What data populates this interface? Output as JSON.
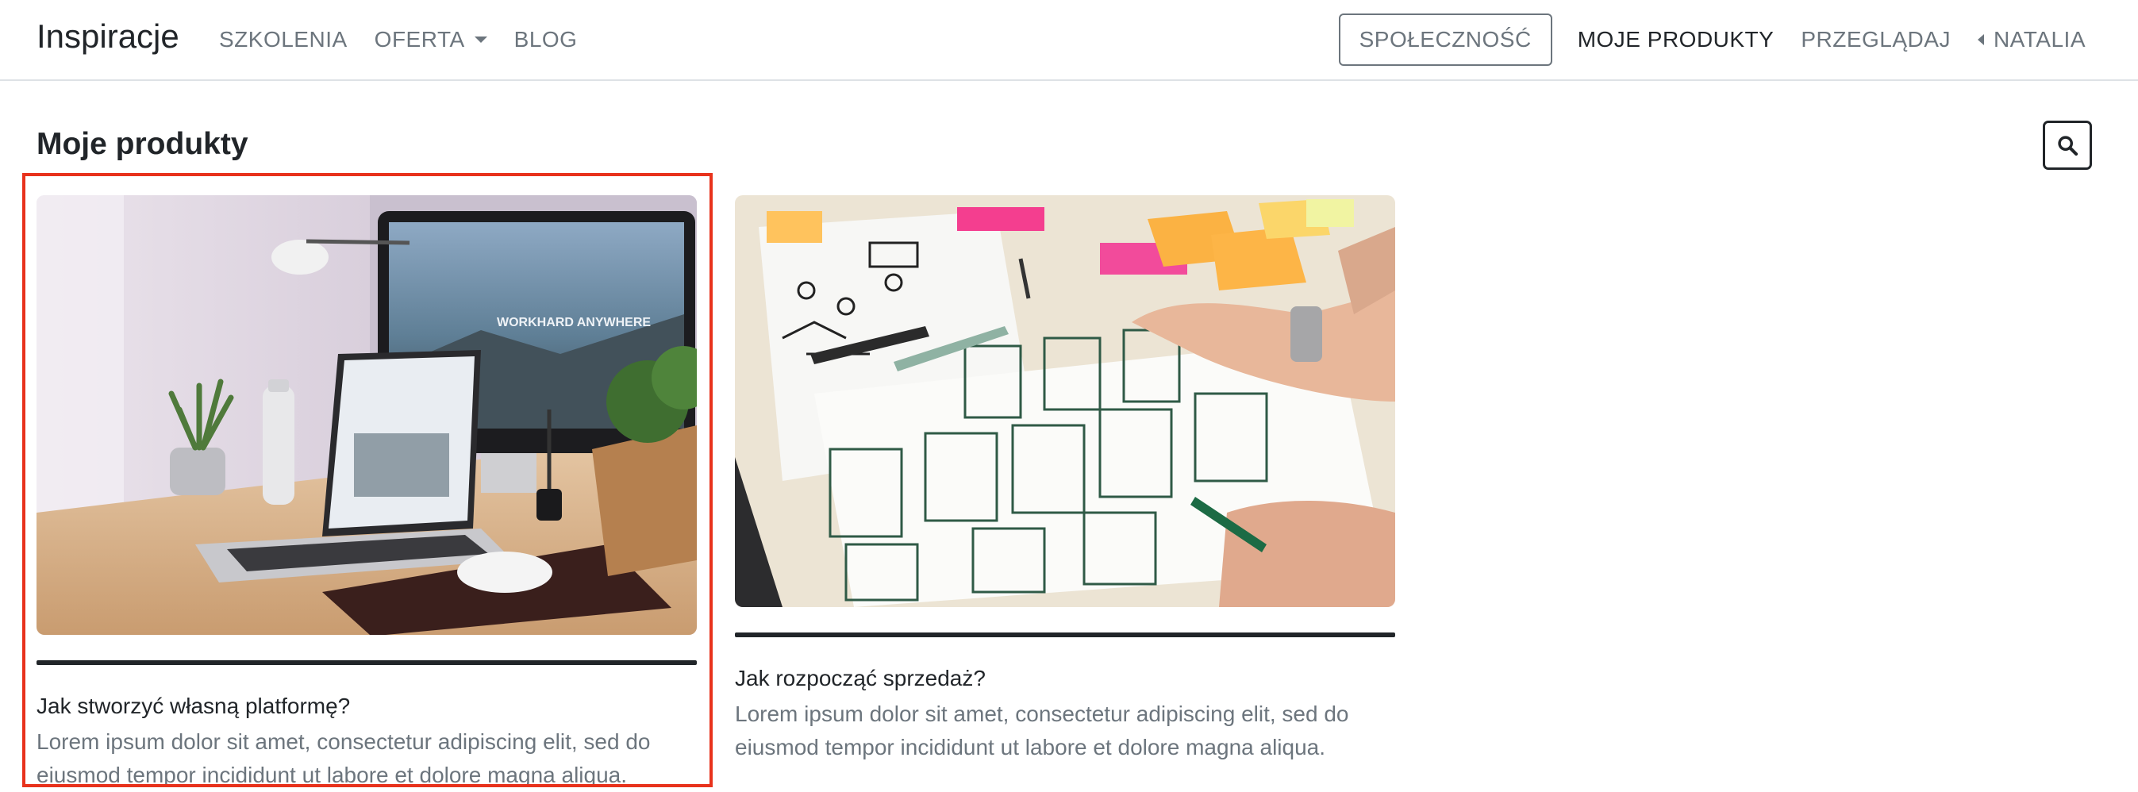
{
  "navbar": {
    "brand": "Inspiracje",
    "left_links": [
      {
        "label": "SZKOLENIA"
      },
      {
        "label": "OFERTA",
        "has_dropdown": true
      },
      {
        "label": "BLOG"
      }
    ],
    "community_button": "SPOŁECZNOŚĆ",
    "right_links": [
      {
        "label": "MOJE PRODUKTY",
        "active": true
      },
      {
        "label": "PRZEGLĄDAJ"
      },
      {
        "label": "NATALIA",
        "has_caret_left": true
      }
    ]
  },
  "main": {
    "title": "Moje produkty",
    "search_icon": "search-icon",
    "cards": [
      {
        "image": "workspace-desk-photo",
        "title": "Jak stworzyć własną platformę?",
        "text": "Lorem ipsum dolor sit amet, consectetur adipiscing elit, sed do eiusmod tempor incididunt ut labore et dolore magna aliqua.",
        "monitor_text": "WORKHARD ANYWHERE",
        "highlighted": true
      },
      {
        "image": "wireframe-sketching-photo",
        "title": "Jak rozpocząć sprzedaż?",
        "text": "Lorem ipsum dolor sit amet, consectetur adipiscing elit, sed do eiusmod tempor incididunt ut labore et dolore magna aliqua."
      }
    ]
  },
  "colors": {
    "text": "#212529",
    "muted": "#6c757d",
    "highlight": "#e8321c",
    "border": "#dee2e6"
  }
}
